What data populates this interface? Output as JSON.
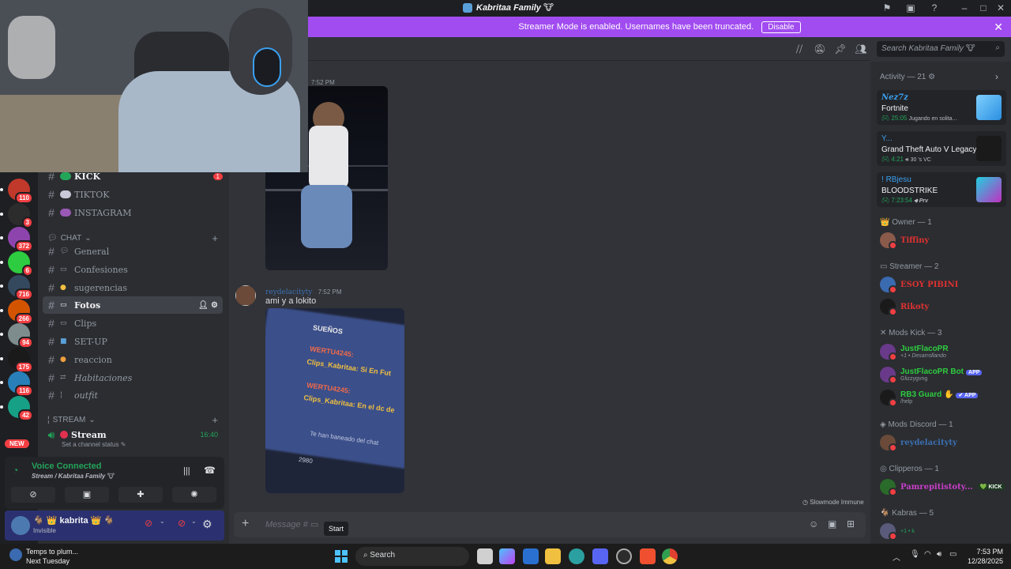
{
  "titlebar": {
    "title": "Kabritaa Family 🐮"
  },
  "banner": {
    "text": "Streamer Mode is enabled. Usernames have been truncated.",
    "disable_label": "Disable"
  },
  "header": {
    "search_placeholder": "Search Kabritaa Family 🐮"
  },
  "servers": [
    {
      "badge": "110"
    },
    {
      "badge": "3"
    },
    {
      "badge": "372"
    },
    {
      "badge": "6"
    },
    {
      "badge": "716"
    },
    {
      "badge": "266"
    },
    {
      "badge": "94"
    },
    {
      "badge": "175"
    },
    {
      "badge": "116"
    },
    {
      "badge": "42"
    }
  ],
  "server_new": "NEW",
  "channels": {
    "top": [
      {
        "name": "KICK",
        "badge": "1"
      },
      {
        "name": "TIKTOK"
      },
      {
        "name": "INSTAGRAM"
      }
    ],
    "chat_category": "CHAT",
    "chat": [
      {
        "name": "General"
      },
      {
        "name": "Confesiones"
      },
      {
        "name": "sugerencias"
      },
      {
        "name": "Fotos"
      },
      {
        "name": "Clips"
      },
      {
        "name": "SET-UP"
      },
      {
        "name": "reaccion"
      },
      {
        "name": "Habitaciones"
      },
      {
        "name": "outfit"
      }
    ],
    "stream_category": "STREAM",
    "stream_channel": "Stream",
    "stream_time": "16:40",
    "stream_status": "Set a channel status"
  },
  "voice": {
    "status": "Voice Connected",
    "channel": "Stream / Kabritaa Family 🐮"
  },
  "user": {
    "name": "kabrita",
    "status": "Invisible"
  },
  "messages": [
    {
      "time": "7:52 PM"
    },
    {
      "author": "reydelacityty",
      "time": "7:52 PM",
      "text": "ami y a lokito"
    }
  ],
  "phone_screen": {
    "lines": [
      "SUEÑOS",
      "WERTU4245:",
      "Clips_Kabritaa: Si En Fut",
      "WERTU4245:",
      "Clips_Kabritaa: En el dc de",
      "Te han baneado del chat",
      "2980"
    ]
  },
  "slowmode": "Slowmode Immune",
  "composer": {
    "placeholder": "Message #"
  },
  "tooltip": "Start",
  "members": {
    "activity_header": "Activity — 21",
    "activities": [
      {
        "user": "Nez7z",
        "game": "Fortnite",
        "time": "25:05",
        "detail": "Jugando en solita..."
      },
      {
        "user": "Y...",
        "game": "Grand Theft Auto V Legacy",
        "time": "4:21",
        "detail": "30",
        "extra": "'s VC"
      },
      {
        "user": "RBjesu",
        "game": "BLOODSTRIKE",
        "time": "7:23:54",
        "detail": "Prv"
      }
    ],
    "owner_header": "Owner — 1",
    "owner": [
      {
        "name": "Tiffiny"
      }
    ],
    "streamer_header": "Streamer — 2",
    "streamer": [
      {
        "name": "ESOY PIBINI"
      },
      {
        "name": "Rikoty"
      }
    ],
    "modskick_header": "Mods Kick — 3",
    "modskick": [
      {
        "name": "JustFlacoPR",
        "sub": "+1 • Desarrollando"
      },
      {
        "name": "JustFlacoPR Bot",
        "sub": "Glizzygvng",
        "tag": "APP"
      },
      {
        "name": "RB3 Guard ✋",
        "sub": "/help",
        "tag": "✔ APP"
      }
    ],
    "modsdiscord_header": "Mods Discord — 1",
    "modsdiscord": [
      {
        "name": "reydelacityty"
      }
    ],
    "clipperos_header": "Clipperos — 1",
    "clipperos": [
      {
        "name": "Pamrepitistoty...",
        "tag": "KICK"
      }
    ],
    "kabras_header": "Kabras — 5",
    "kabras": [
      {
        "name": "",
        "sub": "+1 • k"
      }
    ]
  },
  "taskbar": {
    "weather_title": "Temps to plum...",
    "weather_sub": "Next Tuesday",
    "search": "Search",
    "time": "7:53 PM",
    "date": "12/28/2025"
  },
  "colors": {
    "banner": "#a14cf0",
    "owner": "#e03131",
    "streamer": "#e03131",
    "modskick": "#2ecc40",
    "modsdiscord": "#3b6fb0",
    "clipperos": "#c93ec9"
  }
}
